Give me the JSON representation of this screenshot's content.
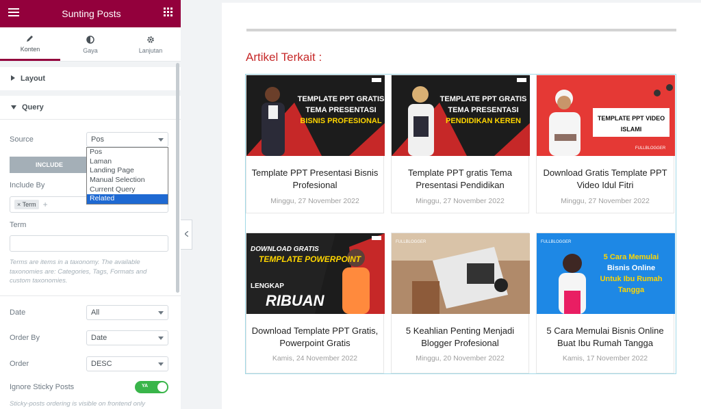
{
  "panel": {
    "title": "Sunting Posts",
    "tabs": [
      {
        "label": "Konten",
        "icon": "pencil-icon"
      },
      {
        "label": "Gaya",
        "icon": "contrast-icon"
      },
      {
        "label": "Lanjutan",
        "icon": "gear-icon"
      }
    ],
    "sections": {
      "layout": "Layout",
      "query": "Query"
    },
    "source": {
      "label": "Source",
      "value": "Pos",
      "options": [
        "Pos",
        "Laman",
        "Landing Page",
        "Manual Selection",
        "Current Query",
        "Related"
      ],
      "highlighted": "Related"
    },
    "include_tab": "INCLUDE",
    "include_by": {
      "label": "Include By",
      "tag": "Term",
      "tag_remove": "×"
    },
    "term": {
      "label": "Term",
      "value": ""
    },
    "term_help": "Terms are items in a taxonomy. The available taxonomies are: Categories, Tags, Formats and custom taxonomies.",
    "date": {
      "label": "Date",
      "value": "All"
    },
    "order_by": {
      "label": "Order By",
      "value": "Date"
    },
    "order": {
      "label": "Order",
      "value": "DESC"
    },
    "ignore_sticky": {
      "label": "Ignore Sticky Posts",
      "toggle_text": "YA",
      "on": true
    },
    "sticky_help": "Sticky-posts ordering is visible on frontend only"
  },
  "preview": {
    "heading": "Artikel Terkait :",
    "posts": [
      {
        "thumb_text": [
          "TEMPLATE PPT GRATIS",
          "TEMA PRESENTASI",
          "BISNIS PROFESIONAL"
        ],
        "title": "Template PPT Presentasi Bisnis Profesional",
        "date": "Minggu, 27 November 2022"
      },
      {
        "thumb_text": [
          "TEMPLATE PPT GRATIS",
          "TEMA PRESENTASI",
          "PENDIDIKAN KEREN"
        ],
        "title": "Template PPT gratis Tema Presentasi Pendidikan",
        "date": "Minggu, 27 November 2022"
      },
      {
        "thumb_text": [
          "TEMPLATE PPT VIDEO",
          "ISLAMI",
          "FULLBLOGGER"
        ],
        "title": "Download Gratis Template PPT Video Idul Fitri",
        "date": "Minggu, 27 November 2022"
      },
      {
        "thumb_text": [
          "DOWNLOAD GRATIS",
          "TEMPLATE POWERPOINT",
          "LENGKAP",
          "RIBUAN"
        ],
        "title": "Download Template PPT Gratis, Powerpoint Gratis",
        "date": "Kamis, 24 November 2022"
      },
      {
        "thumb_text": [
          "FULLBLOGGER"
        ],
        "title": "5 Keahlian Penting Menjadi Blogger Profesional",
        "date": "Minggu, 20 November 2022"
      },
      {
        "thumb_text": [
          "FULLBLOGGER",
          "5 Cara Memulai",
          "Bisnis Online",
          "Untuk Ibu Rumah",
          "Tangga"
        ],
        "title": "5 Cara Memulai Bisnis Online Buat Ibu Rumah Tangga",
        "date": "Kamis, 17 November 2022"
      }
    ]
  },
  "colors": {
    "brand": "#93003c",
    "accent_red": "#c62828",
    "toggle_on": "#39b54a",
    "option_highlight": "#1e69d2"
  }
}
